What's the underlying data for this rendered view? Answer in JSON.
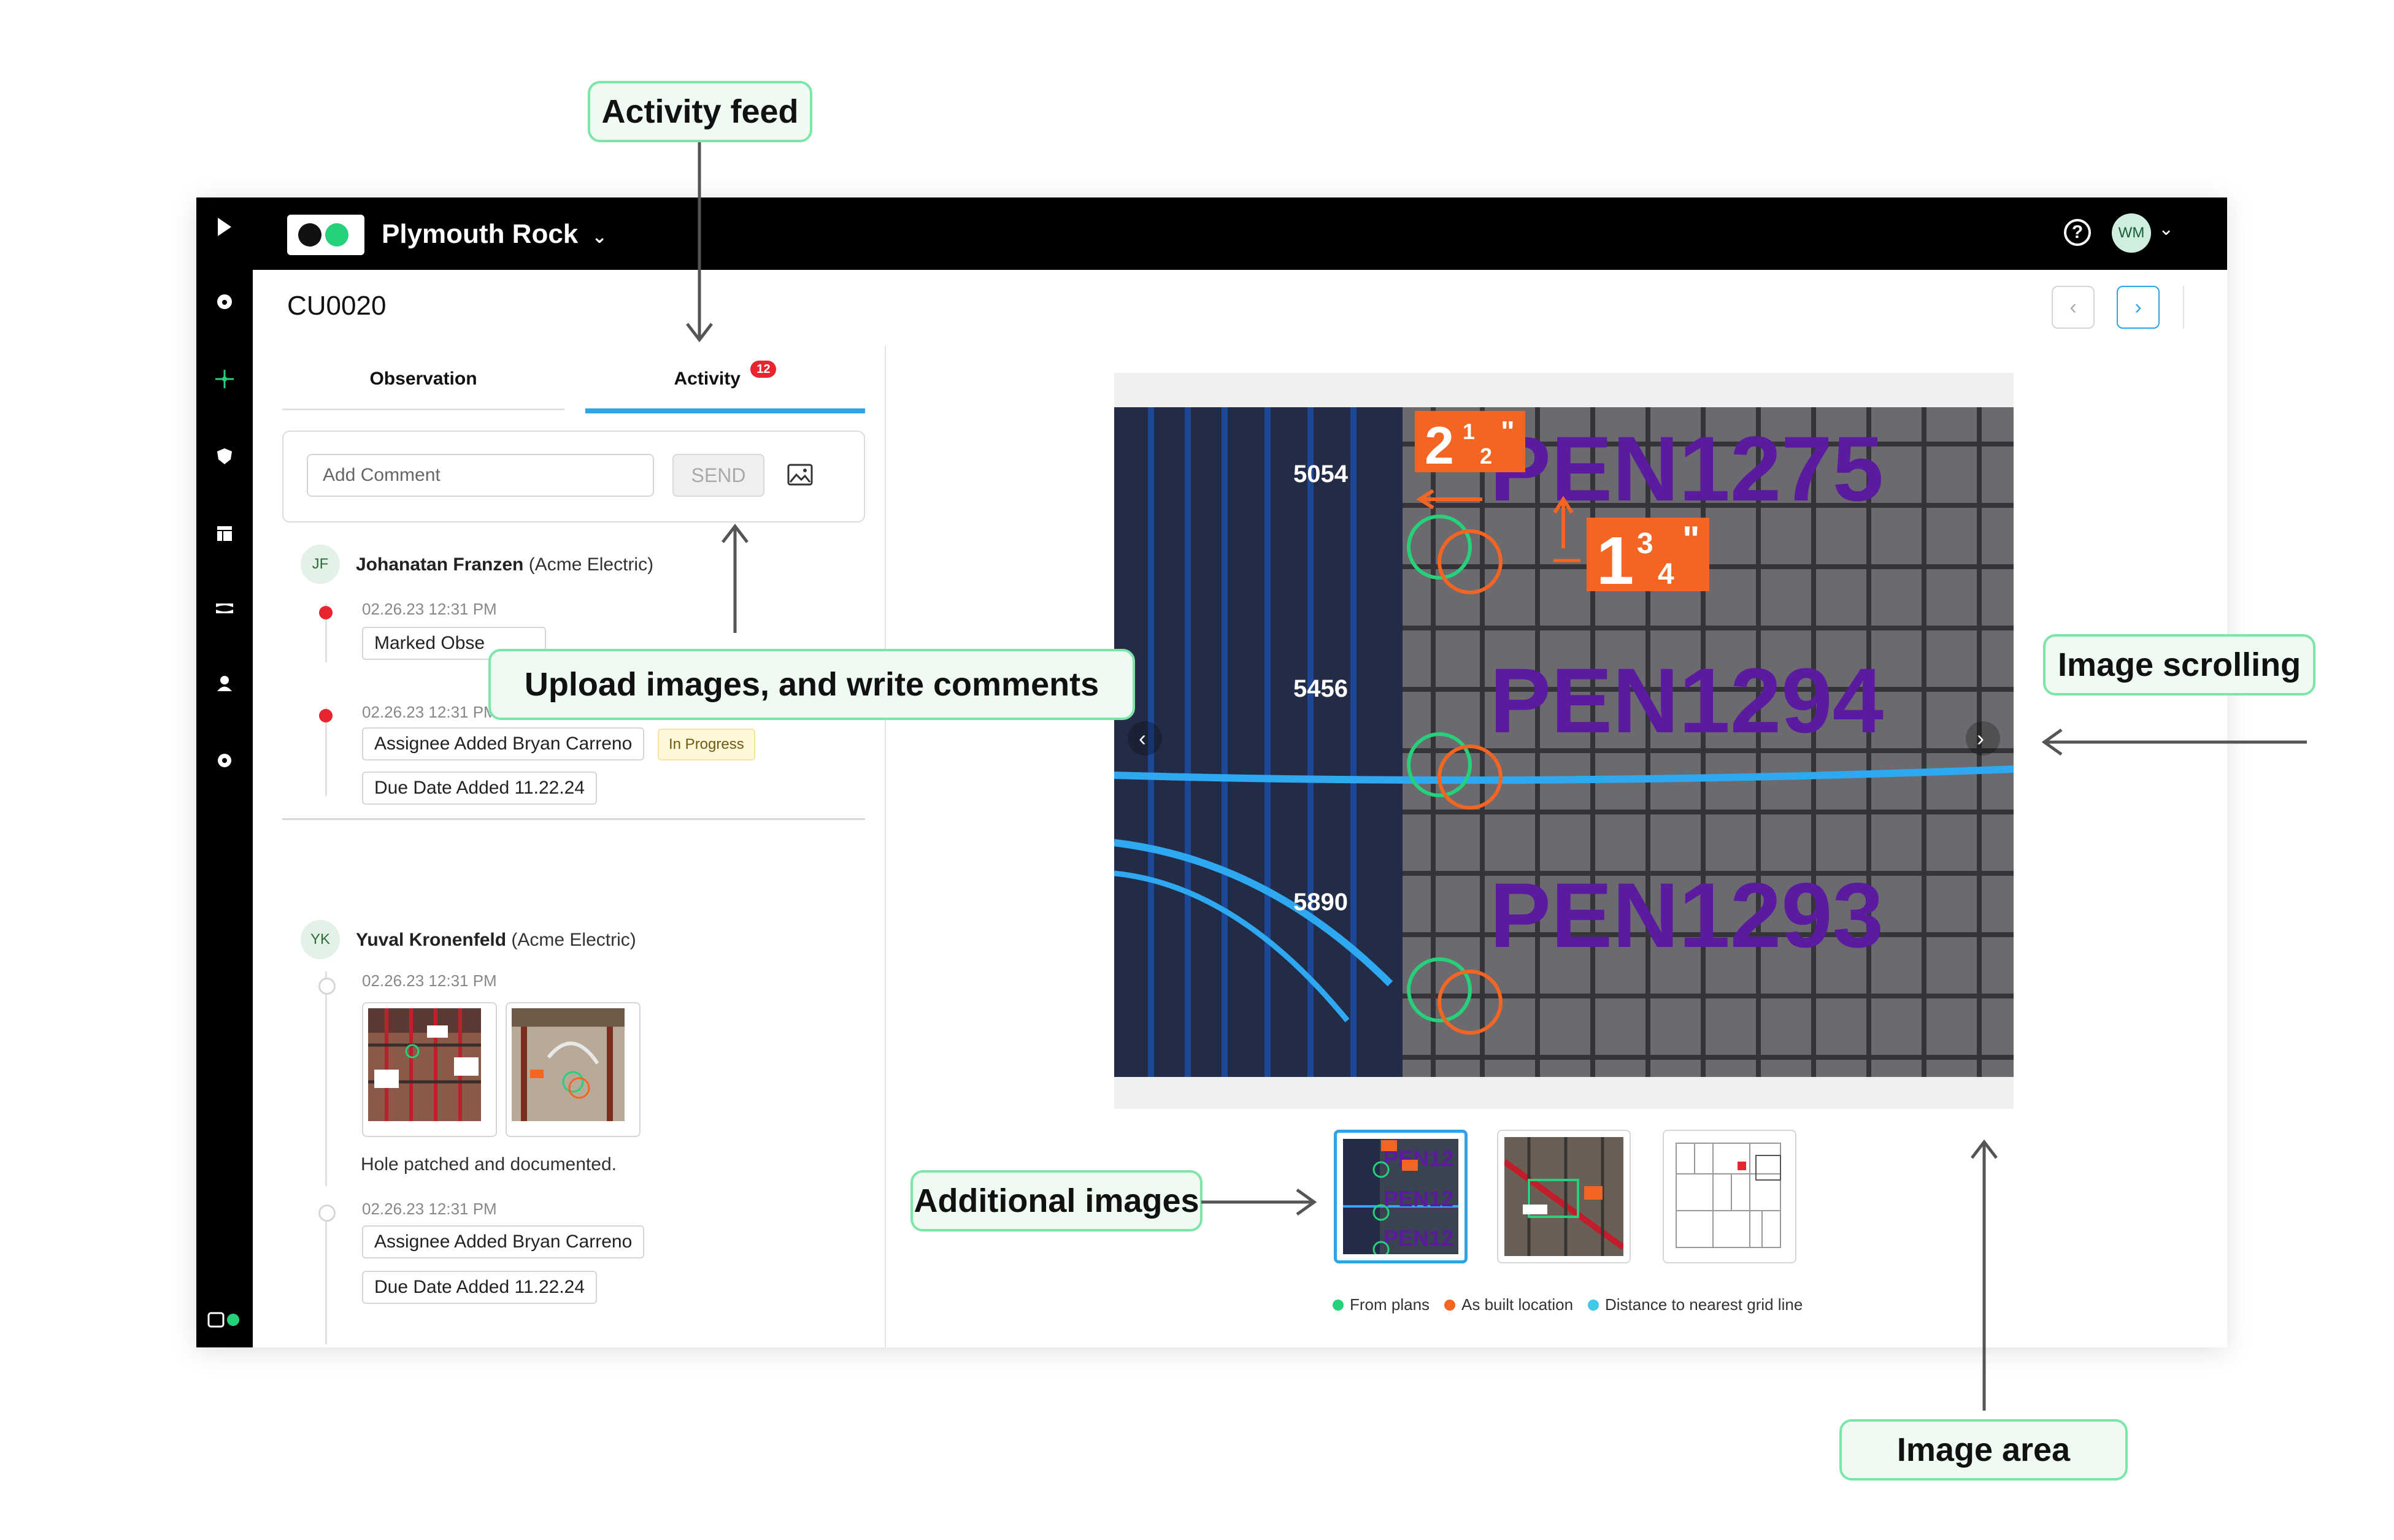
{
  "app": {
    "project_name": "Plymouth Rock",
    "user_initials": "WM",
    "record_id": "CU0020"
  },
  "tabs": {
    "observation": "Observation",
    "activity": "Activity",
    "activity_count": "12"
  },
  "composer": {
    "placeholder": "Add Comment",
    "send_label": "SEND"
  },
  "feed": {
    "entry1": {
      "initials": "JF",
      "name": "Johanatan Franzen",
      "org": "(Acme Electric)",
      "event1_time": "02.26.23 12:31 PM",
      "event1_chip": "Marked Obse",
      "event2_time": "02.26.23 12:31 PM",
      "event2_chip": "Assignee Added Bryan Carreno",
      "event2_status": "In Progress",
      "event2_chip2": "Due Date Added 11.22.24"
    },
    "entry2": {
      "initials": "YK",
      "name": "Yuval Kronenfeld",
      "org": "(Acme Electric)",
      "event1_time": "02.26.23 12:31 PM",
      "comment": "Hole patched and documented.",
      "event2_time": "02.26.23 12:31 PM",
      "event2_chip": "Assignee Added Bryan Carreno",
      "event2_chip2": "Due Date Added 11.22.24"
    }
  },
  "image": {
    "ids": [
      "5054",
      "5456",
      "5890"
    ],
    "labels": [
      "PEN1275",
      "PEN1294",
      "PEN1293"
    ],
    "dim1_whole": "2",
    "dim1_num": "1",
    "dim1_den": "2",
    "dim1_unit": "\"",
    "dim2_whole": "1",
    "dim2_num": "3",
    "dim2_den": "4",
    "dim2_unit": "\"",
    "thumb_labels": [
      "PEN12",
      "PEN12",
      "PEN12"
    ]
  },
  "legend": {
    "from_plans": "From plans",
    "as_built": "As built location",
    "distance": "Distance to nearest grid line"
  },
  "callouts": {
    "activity_feed": "Activity feed",
    "upload": "Upload images, and write comments",
    "image_scrolling": "Image scrolling",
    "additional_images": "Additional images",
    "image_area": "Image area"
  },
  "colors": {
    "accent_green": "#27d07a",
    "accent_blue": "#2ea3e8",
    "dim_orange": "#f26522",
    "label_purple": "#5b1aa0"
  }
}
